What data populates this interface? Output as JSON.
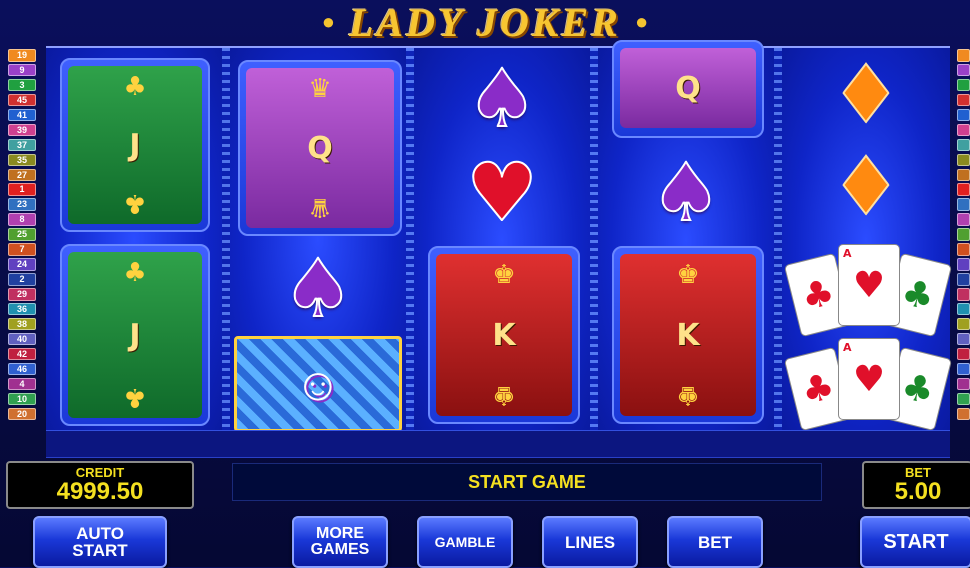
{
  "title": "LADY JOKER",
  "lines_left": [
    {
      "n": "19",
      "c": "#f08a20"
    },
    {
      "n": "9",
      "c": "#9a40c8"
    },
    {
      "n": "3",
      "c": "#20a040"
    },
    {
      "n": "45",
      "c": "#d03030"
    },
    {
      "n": "41",
      "c": "#2060d0"
    },
    {
      "n": "39",
      "c": "#d04090"
    },
    {
      "n": "37",
      "c": "#40a0a0"
    },
    {
      "n": "35",
      "c": "#8a8a20"
    },
    {
      "n": "27",
      "c": "#c07020"
    },
    {
      "n": "1",
      "c": "#e02020"
    },
    {
      "n": "23",
      "c": "#3070c0"
    },
    {
      "n": "8",
      "c": "#b040b0"
    },
    {
      "n": "25",
      "c": "#50a030"
    },
    {
      "n": "7",
      "c": "#d05020"
    },
    {
      "n": "24",
      "c": "#6040c0"
    },
    {
      "n": "2",
      "c": "#2040a0"
    },
    {
      "n": "29",
      "c": "#c03060"
    },
    {
      "n": "36",
      "c": "#2090b0"
    },
    {
      "n": "38",
      "c": "#a0a020"
    },
    {
      "n": "40",
      "c": "#6060c0"
    },
    {
      "n": "42",
      "c": "#c02040"
    },
    {
      "n": "46",
      "c": "#3060d0"
    },
    {
      "n": "4",
      "c": "#a03090"
    },
    {
      "n": "10",
      "c": "#30a050"
    },
    {
      "n": "20",
      "c": "#d07030"
    }
  ],
  "lines_right_colors": [
    "#f08a20",
    "#9a40c8",
    "#20a040",
    "#d03030",
    "#2060d0",
    "#d04090",
    "#40a0a0",
    "#8a8a20",
    "#c07020",
    "#e02020",
    "#3070c0",
    "#b040b0",
    "#50a030",
    "#d05020",
    "#6040c0",
    "#2040a0",
    "#c03060",
    "#2090b0",
    "#a0a020",
    "#6060c0",
    "#c02040",
    "#3060d0",
    "#a03090",
    "#30a050",
    "#d07030"
  ],
  "reels": [
    {
      "symbols": [
        "jack",
        "jack"
      ]
    },
    {
      "symbols": [
        "queen",
        "spade",
        "joker"
      ]
    },
    {
      "symbols": [
        "spade",
        "heart",
        "king"
      ]
    },
    {
      "symbols": [
        "queen",
        "spade",
        "king"
      ]
    },
    {
      "symbols": [
        "diamond",
        "diamond",
        "ace-cards",
        "ace-cards"
      ]
    }
  ],
  "credit": {
    "label": "CREDIT",
    "value": "4999.50"
  },
  "bet": {
    "label": "BET",
    "value": "5.00"
  },
  "status": "START GAME",
  "buttons": {
    "auto_start": [
      "AUTO",
      "START"
    ],
    "more_games": [
      "MORE",
      "GAMES"
    ],
    "gamble": "GAMBLE",
    "lines": "LINES",
    "bet": "BET",
    "start": "START"
  }
}
